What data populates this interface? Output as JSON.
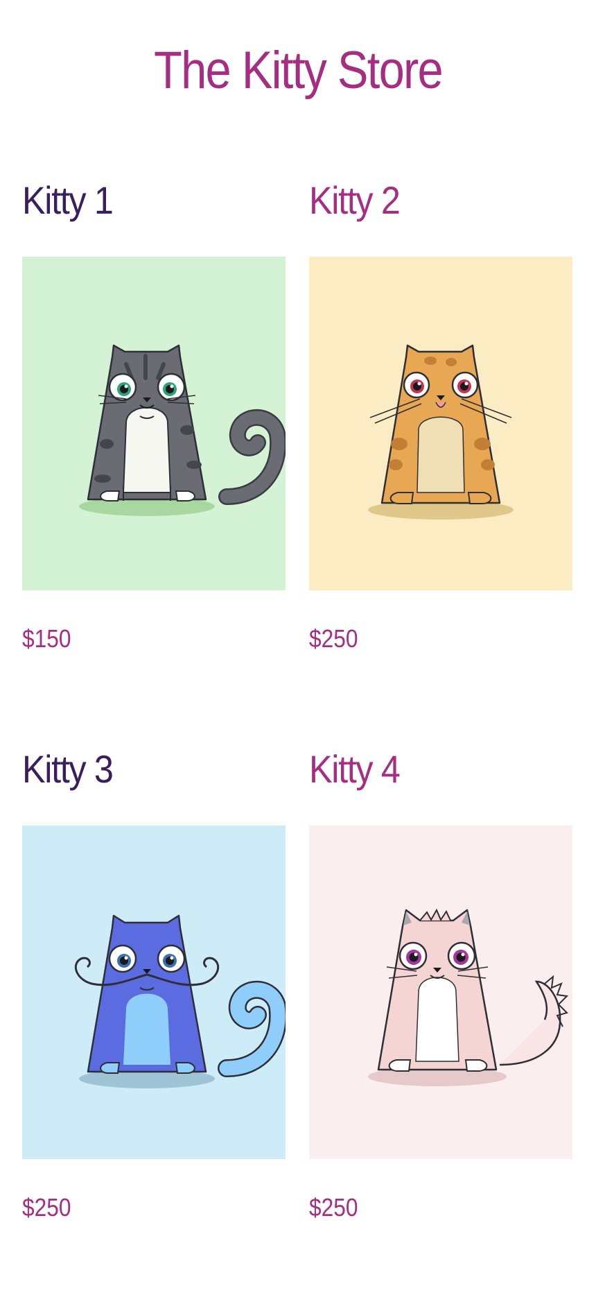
{
  "store": {
    "title": "The Kitty Store"
  },
  "kitties": [
    {
      "name": "Kitty 1",
      "price": "$150",
      "title_color": "#3b1f5c",
      "bg_color": "#d4f3d4",
      "body_color": "#6b6c73",
      "belly_color": "#f7f7f2",
      "icon": "gray-tabby-cat-icon"
    },
    {
      "name": "Kitty 2",
      "price": "$250",
      "title_color": "#a52d82",
      "bg_color": "#fbecc4",
      "body_color": "#e8a752",
      "belly_color": "#f0dfb5",
      "icon": "orange-spotted-cat-icon"
    },
    {
      "name": "Kitty 3",
      "price": "$250",
      "title_color": "#3b1f5c",
      "bg_color": "#ceebf8",
      "body_color": "#5a6ce0",
      "belly_color": "#8fcdfb",
      "icon": "blue-mustache-cat-icon"
    },
    {
      "name": "Kitty 4",
      "price": "$250",
      "title_color": "#a52d82",
      "bg_color": "#fbeeee",
      "body_color": "#f5d4d4",
      "belly_color": "#ffffff",
      "icon": "pink-fluffy-cat-icon"
    }
  ]
}
